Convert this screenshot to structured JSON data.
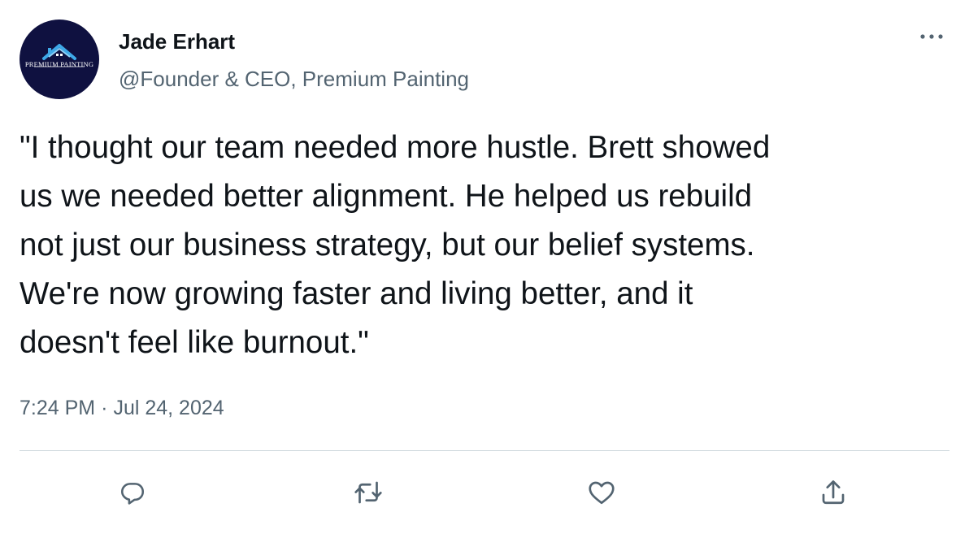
{
  "author": {
    "display_name": "Jade Erhart",
    "handle": "@Founder & CEO, Premium Painting",
    "avatar_logo_text": "PREMIUM PAINTING",
    "avatar_bg_color": "#0f1140"
  },
  "menu": {
    "more_icon": "more-horizontal-icon"
  },
  "tweet": {
    "text": "\"I thought our team needed more hustle. Brett showed\nus we needed better alignment. He helped us rebuild\nnot just our business strategy, but our belief systems.\nWe're now growing faster and living better, and it\ndoesn't feel like burnout.\"",
    "time": "7:24 PM",
    "separator": "·",
    "date": "Jul 24, 2024"
  },
  "actions": [
    {
      "name": "reply",
      "icon": "reply-icon"
    },
    {
      "name": "retweet",
      "icon": "retweet-icon"
    },
    {
      "name": "like",
      "icon": "heart-icon"
    },
    {
      "name": "share",
      "icon": "share-icon"
    }
  ],
  "colors": {
    "text_primary": "#0f1419",
    "text_secondary": "#536471",
    "divider": "#cfd9de",
    "logo_roof": "#3ea9e8"
  }
}
